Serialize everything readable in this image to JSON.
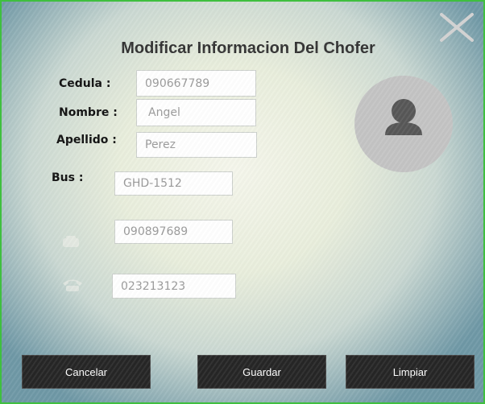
{
  "dialog": {
    "title": "Modificar Informacion Del Chofer"
  },
  "form": {
    "cedula": {
      "label": "Cedula :",
      "value": "090667789"
    },
    "nombre": {
      "label": "Nombre :",
      "value": "Angel"
    },
    "apellido": {
      "label": "Apellido :",
      "value": "Perez"
    },
    "bus": {
      "label": "Bus :",
      "value": "GHD-1512"
    },
    "celular": {
      "icon": "mobile-phone-icon",
      "value": "090897689"
    },
    "telefono": {
      "icon": "telephone-icon",
      "value": "023213123"
    }
  },
  "avatar": {
    "icon": "user-icon"
  },
  "buttons": {
    "cancel": "Cancelar",
    "save": "Guardar",
    "clear": "Limpiar"
  },
  "colors": {
    "border": "#3fbf3f",
    "button_bg": "#262626",
    "avatar_bg": "#c4c4c4"
  }
}
